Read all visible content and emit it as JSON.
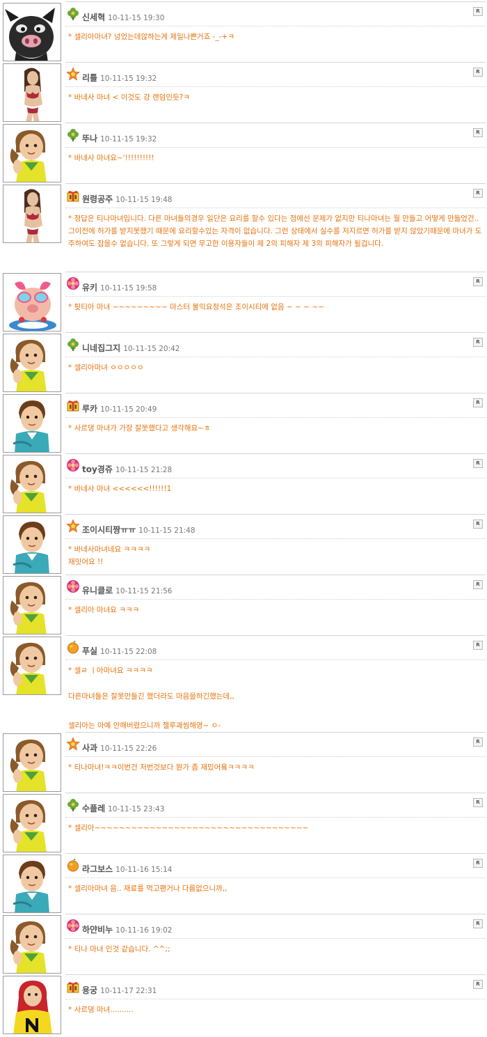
{
  "reply_button_label": "R",
  "comments": [
    {
      "avatar": "pig-avatar-icon",
      "badge": "green-clover-badge-icon",
      "author": "신세혁",
      "date": "10-11-15 19:30",
      "lines": [
        "* 셀리아마녀? 넝었는데않하는게 제일나쁜거죠 -_-+ㅋ"
      ]
    },
    {
      "avatar": "woman-avatar-icon",
      "badge": "orange-flower-badge-icon",
      "author": "리틀",
      "date": "10-11-15 19:32",
      "lines": [
        "* 바네사 마녀 < 이것도 걍 랜덤인듯?ㅋ"
      ]
    },
    {
      "avatar": "girl-avatar-icon",
      "badge": "green-clover-badge-icon",
      "author": "뚜나",
      "date": "10-11-15 19:32",
      "lines": [
        "* 바네사 마녀요~'!!!!!!!!!!"
      ]
    },
    {
      "avatar": "woman-avatar-icon",
      "badge": "gift-box-badge-icon",
      "author": "원령공주",
      "date": "10-11-15 19:48",
      "lines": [
        "* 정답은 티나마녀입니다. 다른 마녀들의경우 일단은 요리를 할수 있다는 점에선 문제가 없지만 티나마녀는 뭘 만들고 어떻게 만들었건.. 그이전에 허가를 받지못했기 때문에 요리할수있는 자격이 없습니다. 그런 상태에서 실수를 저지르면 허가를 받지 않았기때문에 마녀가 도주하여도 잡을수 없습니다. 또 그렇게 되면 무고한 이용자들이 제 2의 피해자 제 3의 피해자가 될겁니다."
      ]
    },
    {
      "avatar": "pig-swimmer-avatar-icon",
      "badge": "pink-flower-badge-icon",
      "author": "유키",
      "date": "10-11-15 19:58",
      "lines": [
        "* 틧티아 마녀 ~~~~~~~~~ 마스터 불익요정석은 조이시티에 없음 ~ ~  ~ ~~"
      ]
    },
    {
      "avatar": "girl-avatar-icon",
      "badge": "green-clover-badge-icon",
      "author": "니네집그지",
      "date": "10-11-15 20:42",
      "lines": [
        "* 셀리아마녀 ㅇㅇㅇㅇㅇ"
      ]
    },
    {
      "avatar": "boy-avatar-icon",
      "badge": "gift-box-badge-icon",
      "author": "루카",
      "date": "10-11-15 20:49",
      "lines": [
        "* 사르댕 마녀가 가장 잘못했다고 생각해요~ㅎ"
      ]
    },
    {
      "avatar": "girl-avatar-icon",
      "badge": "pink-flower-badge-icon",
      "author": "toy경쥬",
      "date": "10-11-15 21:28",
      "lines": [
        "* 바네사 마녀 <<<<<<!!!!!!1"
      ]
    },
    {
      "avatar": "boy-avatar-icon",
      "badge": "orange-flower-badge-icon",
      "author": "조이시티짱ㅠㅠ",
      "date": "10-11-15 21:48",
      "lines": [
        "* 바네사마녀네요 ㅋㅋㅋㅋ",
        "재밋어요 !!"
      ]
    },
    {
      "avatar": "girl-avatar-icon",
      "badge": "pink-flower-badge-icon",
      "author": "유니클로",
      "date": "10-11-15 21:56",
      "lines": [
        "* 셀리아 마녀요 ㅋㅋㅋ"
      ]
    },
    {
      "avatar": "girl-avatar-icon",
      "badge": "orange-fruit-badge-icon",
      "author": "푸실",
      "date": "10-11-15 22:08",
      "lines": [
        "* 셀ㄹ ㅣ아마녀요 ㅋㅋㅋㅋ"
      ],
      "extra_lines": [
        "다른마녀들은 잘못만들긴 했더라도 마음을하긴했는데,,",
        "셀리아는 아예 안해버렸으니까 젤루괘씸해영~ ㅇ-"
      ]
    },
    {
      "avatar": "girl-avatar-icon",
      "badge": "orange-flower-badge-icon",
      "author": "사과",
      "date": "10-11-15 22:26",
      "lines": [
        "* 티나마녀!ㅋㅋ이번건 저번것보다 뭔가 좀 재밌어욬ㅋㅋㅋㅋ"
      ]
    },
    {
      "avatar": "girl-avatar-icon",
      "badge": "green-clover-badge-icon",
      "author": "수플레",
      "date": "10-11-15 23:43",
      "lines": [
        "* 셀리아~~~~~~~~~~~~~~~~~~~~~~~~~~~~~~~~~~~"
      ]
    },
    {
      "avatar": "boy-avatar-icon",
      "badge": "orange-fruit-badge-icon",
      "author": "라그보스",
      "date": "10-11-16 15:14",
      "lines": [
        "* 셀리아마녀 음.. 재료를 먹고팬거나 다름없으니까,,"
      ]
    },
    {
      "avatar": "girl-avatar-icon",
      "badge": "pink-flower-badge-icon",
      "author": "하얀비누",
      "date": "10-11-16 19:02",
      "lines": [
        "* 티나 마녀 인것 같습니다. ^^;;"
      ]
    },
    {
      "avatar": "redhair-avatar-icon",
      "badge": "gift-box-badge-icon",
      "author": "용궁",
      "date": "10-11-17 22:31",
      "lines": [
        "* 사르댕 마녀.........."
      ]
    }
  ]
}
